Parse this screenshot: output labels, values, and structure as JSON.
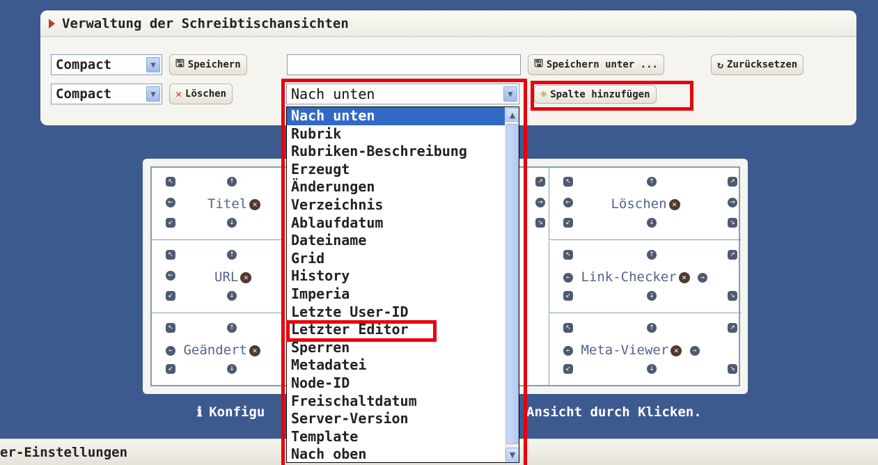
{
  "panel": {
    "title": "Verwaltung der Schreibtischansichten",
    "view_select_1": "Compact",
    "view_select_2": "Compact",
    "save_label": "Speichern",
    "save_as_label": "Speichern unter ...",
    "reset_label": "Zurücksetzen",
    "delete_label": "Löschen",
    "add_column_label": "Spalte hinzufügen",
    "name_input_value": ""
  },
  "dropdown": {
    "selected": "Nach unten",
    "items": [
      "Nach unten",
      "Rubrik",
      "Rubriken-Beschreibung",
      "Erzeugt",
      "Änderungen",
      "Verzeichnis",
      "Ablaufdatum",
      "Dateiname",
      "Grid",
      "History",
      "Imperia",
      "Letzte User-ID",
      "Letzter Editor",
      "Sperren",
      "Metadatei",
      "Node-ID",
      "Freischaltdatum",
      "Server-Version",
      "Template",
      "Nach oben"
    ]
  },
  "grid": {
    "cells": [
      {
        "label": "Titel"
      },
      {
        "label": "Löschen"
      },
      {
        "label": "URL"
      },
      {
        "label": "Link-Checker"
      },
      {
        "label": "Geändert"
      },
      {
        "label": "Meta-Viewer"
      }
    ]
  },
  "info": {
    "text_left": "Konfigu",
    "text_right": "Ansicht durch Klicken."
  },
  "bottom": {
    "title": "er-Einstellungen"
  },
  "colors": {
    "background": "#3d5a8e",
    "highlight": "#e8000d",
    "selection": "#316ac5"
  }
}
